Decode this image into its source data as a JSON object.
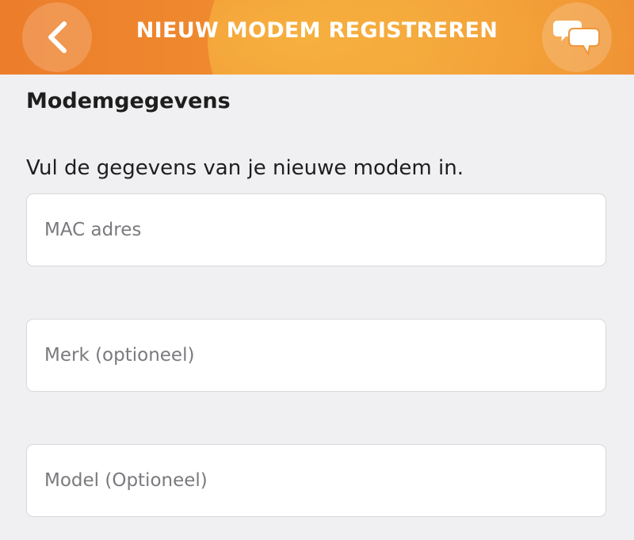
{
  "header": {
    "title": "NIEUW MODEM REGISTREREN",
    "back_icon": "chevron-left-icon",
    "chat_icon": "chat-bubbles-icon",
    "gradient_colors": [
      "#ec7d2b",
      "#f2a13a"
    ]
  },
  "section": {
    "title": "Modemgegevens",
    "instruction": "Vul de gegevens van je nieuwe modem in."
  },
  "form": {
    "mac_address": {
      "value": "",
      "placeholder": "MAC adres"
    },
    "brand": {
      "value": "",
      "placeholder": "Merk (optioneel)"
    },
    "model": {
      "value": "",
      "placeholder": "Model (Optioneel)"
    }
  }
}
